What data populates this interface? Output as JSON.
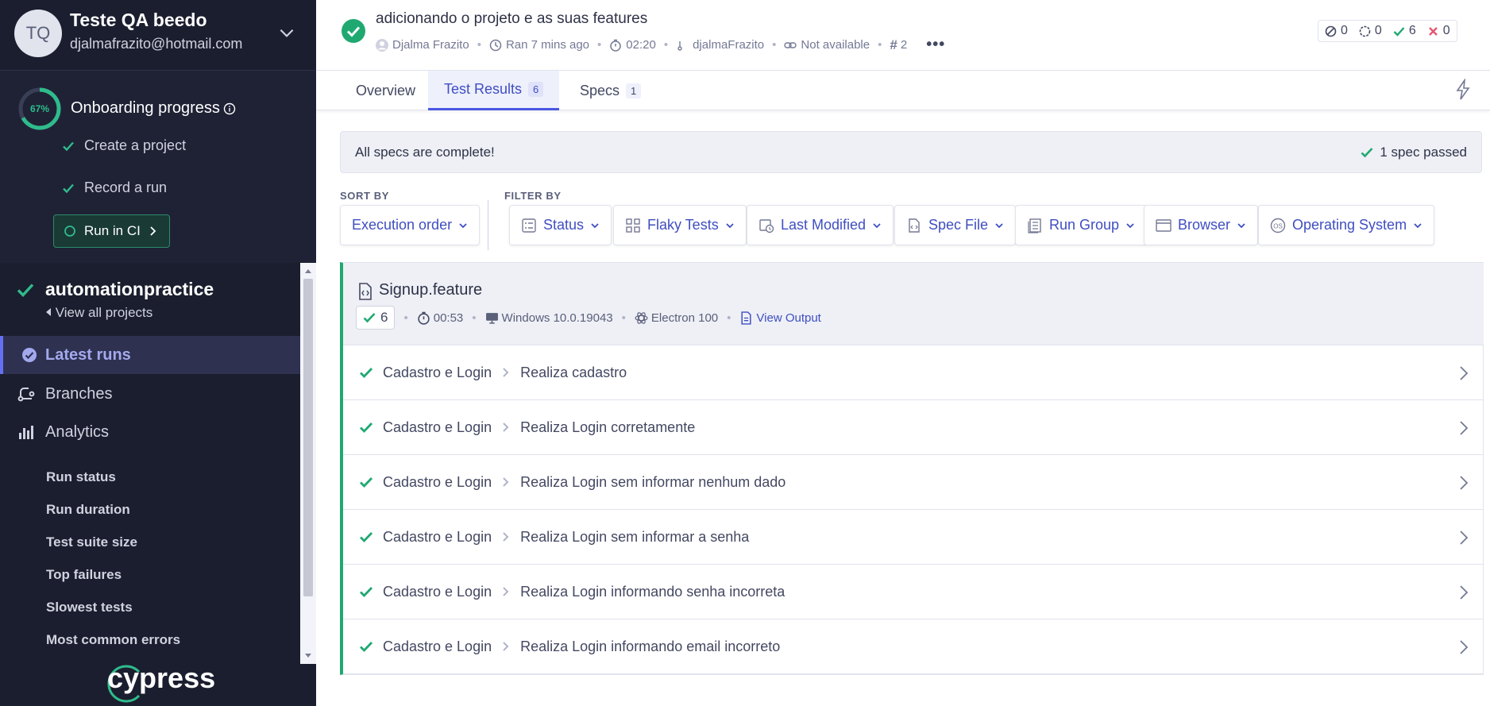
{
  "org": {
    "initials": "TQ",
    "name": "Teste QA beedo",
    "email": "djalmafrazito@hotmail.com"
  },
  "onboarding": {
    "percent_label": "67%",
    "progress": 0.67,
    "title": "Onboarding progress",
    "items": [
      "Create a project",
      "Record a run"
    ],
    "run_in_ci": "Run in CI"
  },
  "project": {
    "name": "automationpractice",
    "view_all": "View all projects"
  },
  "nav": {
    "items": [
      {
        "label": "Latest runs",
        "icon": "check-circle-icon"
      },
      {
        "label": "Branches",
        "icon": "branch-icon"
      },
      {
        "label": "Analytics",
        "icon": "bar-chart-icon"
      }
    ],
    "analytics_sub": [
      "Run status",
      "Run duration",
      "Test suite size",
      "Top failures",
      "Slowest tests",
      "Most common errors"
    ]
  },
  "logo": "cypress",
  "run": {
    "title": "adicionando o projeto e as suas features",
    "author": "Djalma Frazito",
    "ran": "Ran 7 mins ago",
    "duration": "02:20",
    "committer": "djalmaFrazito",
    "ci": "Not available",
    "number": "2",
    "counts": {
      "skipped": "0",
      "pending": "0",
      "passed": "6",
      "failed": "0"
    }
  },
  "tabs": [
    {
      "label": "Overview",
      "badge": ""
    },
    {
      "label": "Test Results",
      "badge": "6"
    },
    {
      "label": "Specs",
      "badge": "1"
    }
  ],
  "banner": {
    "left": "All specs are complete!",
    "right": "1 spec passed"
  },
  "sort": {
    "label": "SORT BY",
    "value": "Execution order"
  },
  "filter": {
    "label": "FILTER BY",
    "items": [
      "Status",
      "Flaky Tests",
      "Last Modified",
      "Spec File",
      "Run Group",
      "Browser",
      "Operating System"
    ]
  },
  "spec": {
    "name": "Signup.feature",
    "passed": "6",
    "duration": "00:53",
    "os": "Windows 10.0.19043",
    "browser": "Electron 100",
    "view_output": "View Output"
  },
  "tests": [
    {
      "suite": "Cadastro e Login",
      "name": "Realiza cadastro"
    },
    {
      "suite": "Cadastro e Login",
      "name": "Realiza Login corretamente"
    },
    {
      "suite": "Cadastro e Login",
      "name": "Realiza Login sem informar nenhum dado"
    },
    {
      "suite": "Cadastro e Login",
      "name": "Realiza Login sem informar a senha"
    },
    {
      "suite": "Cadastro e Login",
      "name": "Realiza Login informando senha incorreta"
    },
    {
      "suite": "Cadastro e Login",
      "name": "Realiza Login informando email incorreto"
    }
  ],
  "colors": {
    "sidebar_bg": "#1b1e2e",
    "accent": "#3f4ec1",
    "success": "#1fa971",
    "failed": "#e45770"
  }
}
